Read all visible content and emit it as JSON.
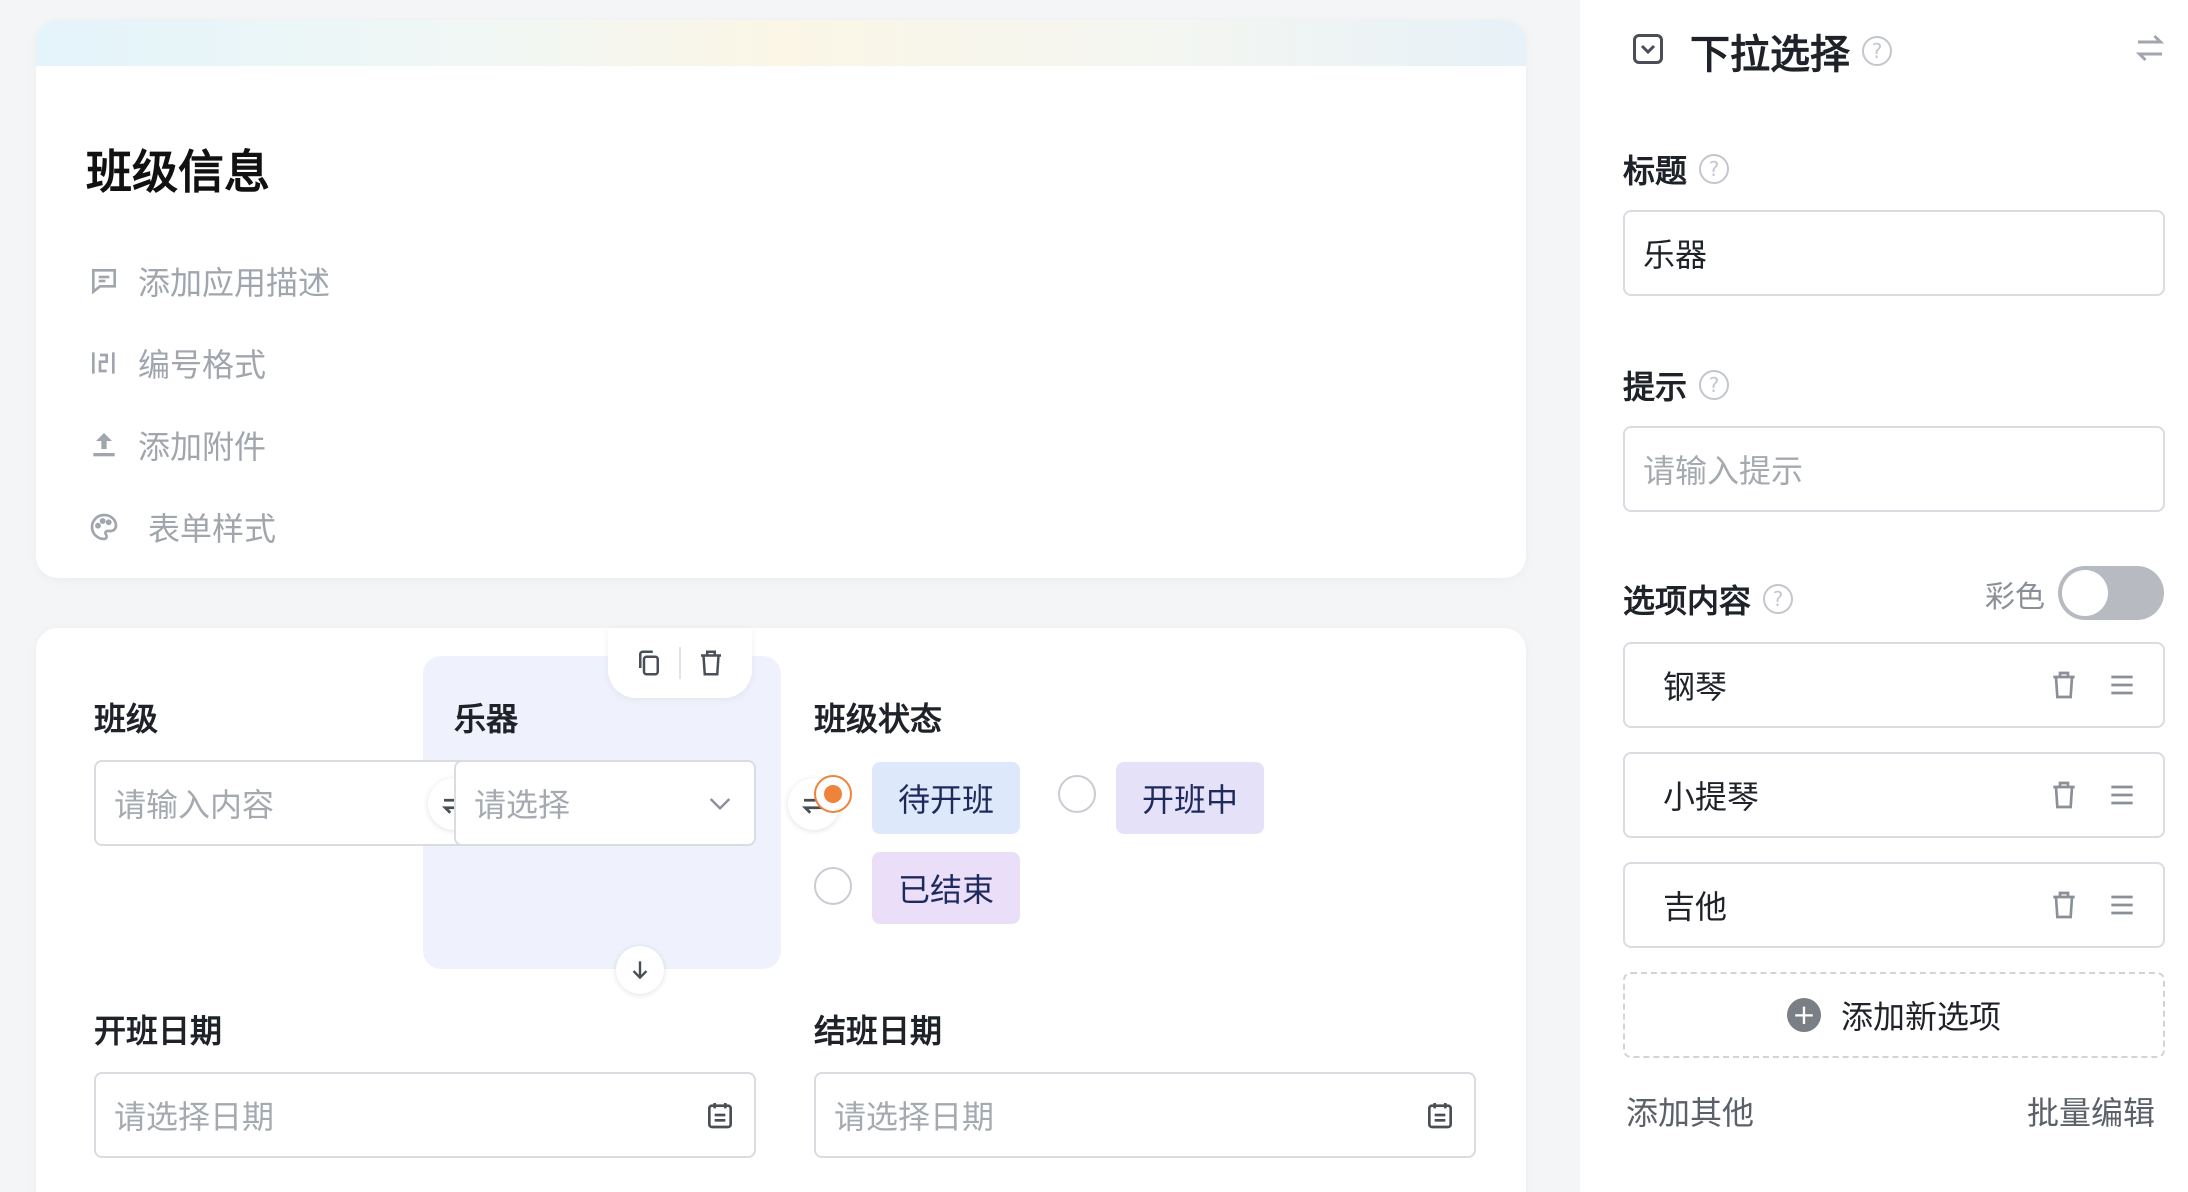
{
  "info": {
    "title": "班级信息",
    "items": [
      {
        "label": "添加应用描述",
        "icon": "comment-icon"
      },
      {
        "label": "编号格式",
        "icon": "number-format-icon"
      },
      {
        "label": "添加附件",
        "icon": "upload-icon"
      },
      {
        "label": "表单样式",
        "icon": "palette-icon"
      }
    ]
  },
  "form": {
    "class_field": {
      "label": "班级",
      "placeholder": "请输入内容"
    },
    "instrument_field": {
      "label": "乐器",
      "placeholder": "请选择"
    },
    "status_field": {
      "label": "班级状态",
      "options": [
        {
          "label": "待开班",
          "checked": true
        },
        {
          "label": "开班中",
          "checked": false
        },
        {
          "label": "已结束",
          "checked": false
        }
      ]
    },
    "start_date_field": {
      "label": "开班日期",
      "placeholder": "请选择日期"
    },
    "end_date_field": {
      "label": "结班日期",
      "placeholder": "请选择日期"
    }
  },
  "panel": {
    "title": "下拉选择",
    "title_label": "标题",
    "title_value": "乐器",
    "hint_label": "提示",
    "hint_placeholder": "请输入提示",
    "options_label": "选项内容",
    "color_label": "彩色",
    "color_enabled": false,
    "options": [
      "钢琴",
      "小提琴",
      "吉他"
    ],
    "add_option": "添加新选项",
    "add_other": "添加其他",
    "batch_edit": "批量编辑"
  },
  "colors": {
    "radio_checked": "#f0833a",
    "chip_blue": "#dde8fb",
    "chip_lavender": "#e4e1f8",
    "chip_purple": "#ebdef8",
    "selected_field_bg": "#eff2fc"
  }
}
